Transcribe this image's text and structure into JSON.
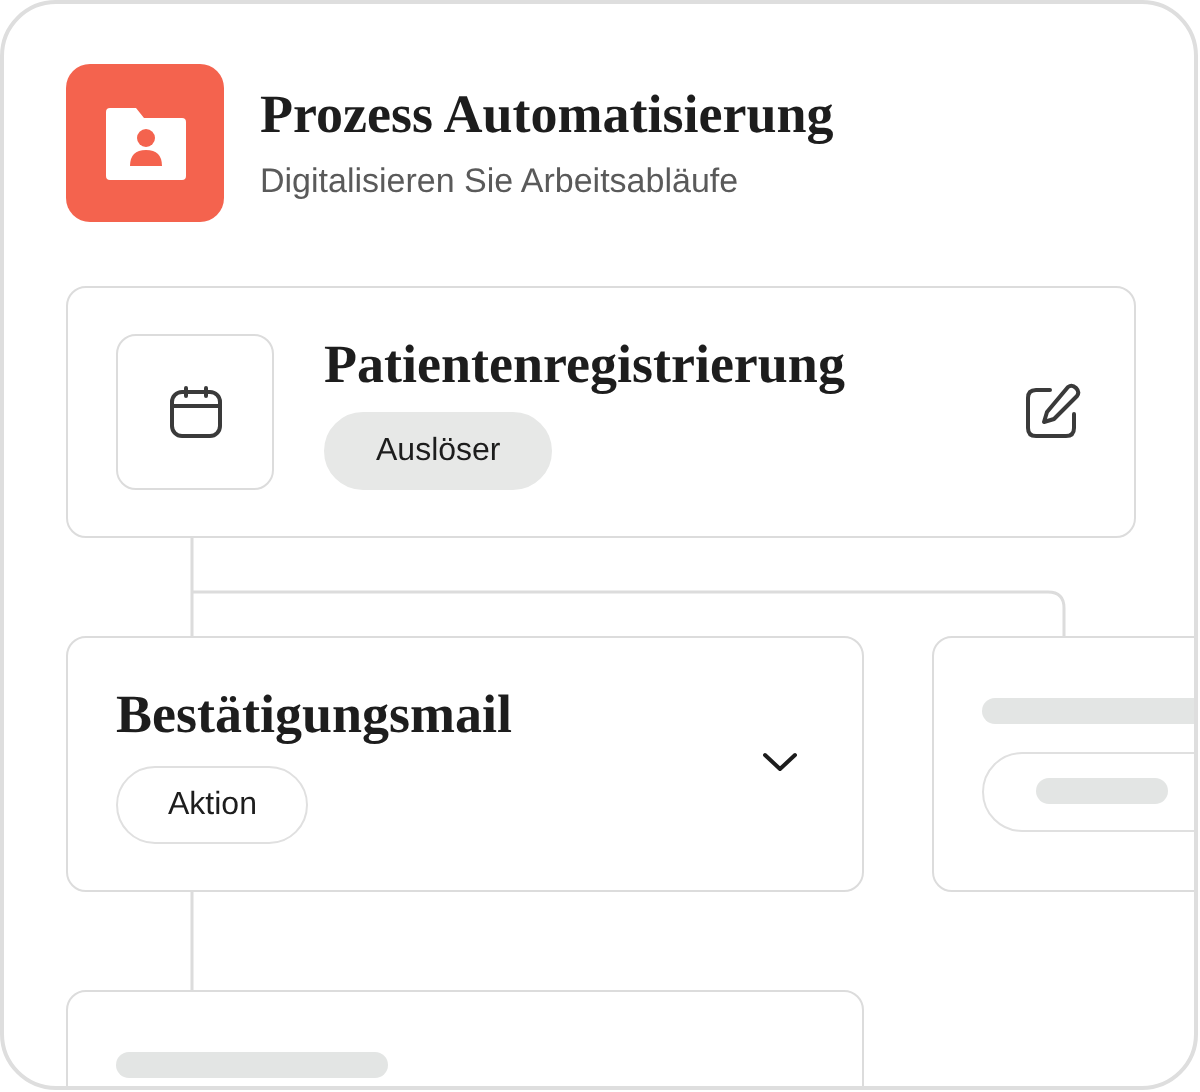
{
  "header": {
    "title": "Prozess Automatisierung",
    "subtitle": "Digitalisieren Sie Arbeitsabläufe"
  },
  "trigger": {
    "title": "Patientenregistrierung",
    "tag": "Auslöser"
  },
  "branches": [
    {
      "kind": "action",
      "title": "Bestätigungsmail",
      "tag": "Aktion",
      "expanded": false
    },
    {
      "kind": "placeholder"
    }
  ],
  "next_step": {
    "kind": "placeholder"
  }
}
